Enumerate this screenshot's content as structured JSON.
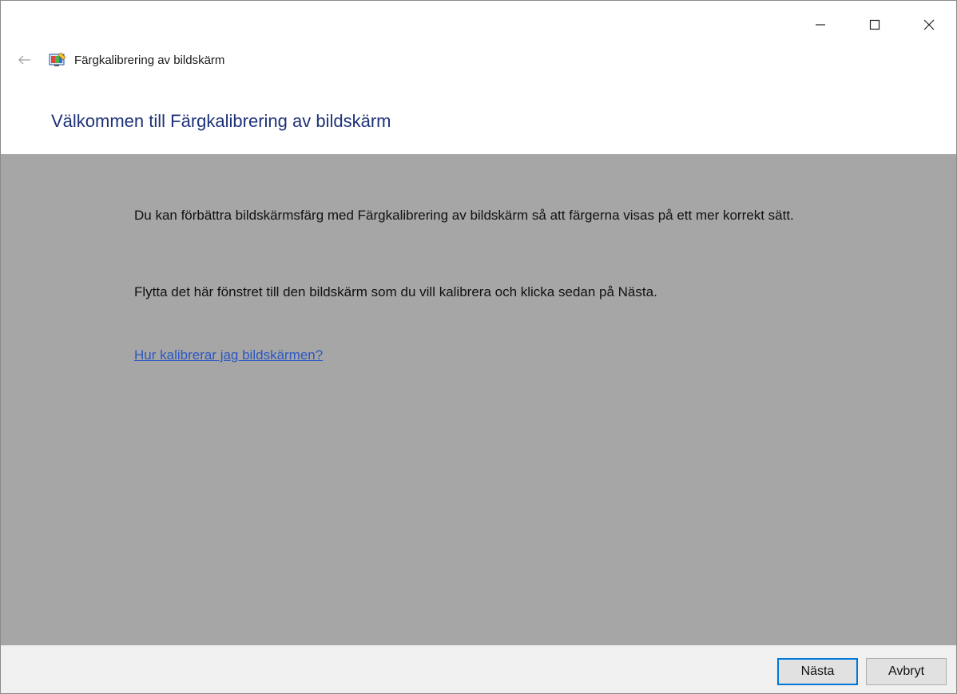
{
  "window": {
    "app_title": "Färgkalibrering av bildskärm",
    "caption_buttons": [
      "minimize-icon",
      "maximize-icon",
      "close-icon"
    ]
  },
  "header": {
    "back_icon": "back-arrow-icon",
    "app_icon": "color-calibration-icon"
  },
  "page": {
    "title": "Välkommen till Färgkalibrering av bildskärm",
    "paragraph1": "Du kan förbättra bildskärmsfärg med Färgkalibrering av bildskärm så att färgerna visas på ett mer korrekt sätt.",
    "paragraph2": "Flytta det här fönstret till den bildskärm som du vill kalibrera och klicka sedan på Nästa.",
    "help_link": "Hur kalibrerar jag bildskärmen?"
  },
  "footer": {
    "next_label": "Nästa",
    "cancel_label": "Avbryt"
  },
  "colors": {
    "title": "#1e3278",
    "link": "#2b57c4",
    "content_bg": "#a6a6a6",
    "footer_bg": "#f0f0f0",
    "focus_border": "#0078d7"
  }
}
